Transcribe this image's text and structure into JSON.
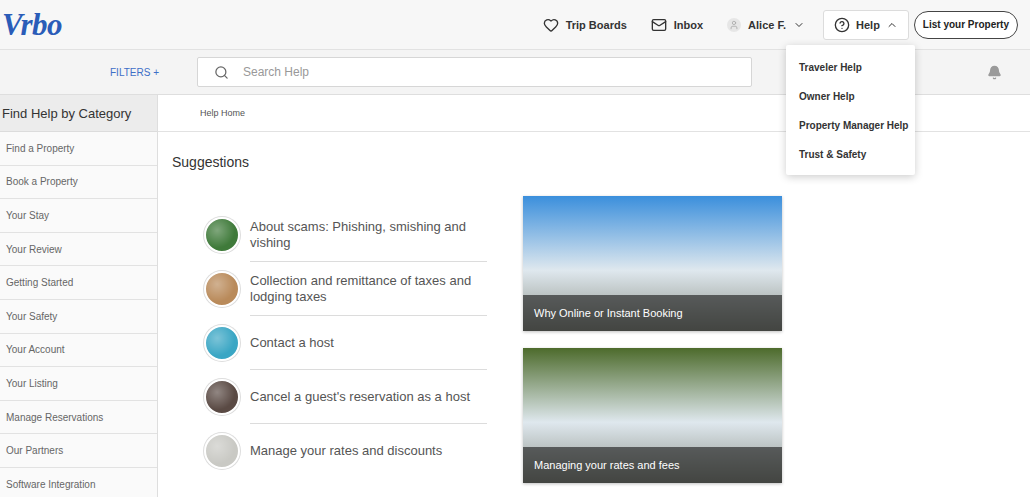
{
  "logo": "Vrbo",
  "header": {
    "trip_boards": "Trip Boards",
    "inbox": "Inbox",
    "user": "Alice F.",
    "help": {
      "label": "Help",
      "expanded": true
    },
    "list_property": "List your Property"
  },
  "help_menu": [
    "Traveler Help",
    "Owner Help",
    "Property Manager Help",
    "Trust & Safety"
  ],
  "filters": "FILTERS +",
  "search": {
    "placeholder": "Search Help"
  },
  "sidebar": {
    "title": "Find Help by Category",
    "items": [
      "Find a Property",
      "Book a Property",
      "Your Stay",
      "Your Review",
      "Getting Started",
      "Your Safety",
      "Your Account",
      "Your Listing",
      "Manage Reservations",
      "Our Partners",
      "Software Integration"
    ]
  },
  "breadcrumb": "Help Home",
  "suggestions": {
    "title": "Suggestions",
    "items": [
      {
        "label": "About scams: Phishing, smishing and vishing",
        "color": "#3f7a3a"
      },
      {
        "label": "Collection and remittance of taxes and lodging taxes",
        "color": "#b98a5a"
      },
      {
        "label": "Contact a host",
        "color": "#3aa6c4"
      },
      {
        "label": "Cancel a guest's reservation as a host",
        "color": "#5a4a44"
      },
      {
        "label": "Manage your rates and discounts",
        "color": "#c9c9c4"
      }
    ]
  },
  "cards": [
    {
      "caption": "Why Online or Instant Booking",
      "color": "#3b8fdc"
    },
    {
      "caption": "Managing your rates and fees",
      "color": "#4d6b2c"
    }
  ]
}
